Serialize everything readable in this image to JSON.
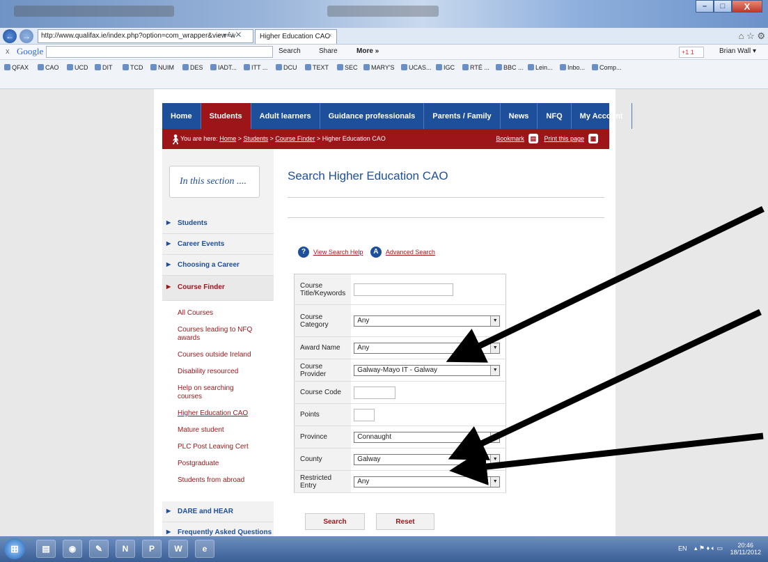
{
  "browser": {
    "address": "http://www.qualifax.ie/index.php?option=com_wrapper&view=w",
    "tab_title": "Higher Education CAO",
    "tab_close": "×",
    "nav_back": "←",
    "nav_forward": "→",
    "address_controls": "⌕ ▾ ↻ ✕",
    "home_star_gear": "⌂ ☆ ⚙",
    "window_buttons": {
      "minimize": "–",
      "maximize": "□",
      "close": "X"
    }
  },
  "google_toolbar": {
    "close": "x",
    "logo": "Google",
    "search_label": "Search",
    "share_label": "Share",
    "more_label": "More »",
    "plus_one": "+1  1",
    "user": "Brian Wall ▾"
  },
  "favorites": [
    "QFAX",
    "CAO",
    "UCD",
    "DIT",
    "TCD",
    "NUIM",
    "DES",
    "IADT...",
    "ITT ...",
    "DCU",
    "TEXT",
    "SEC",
    "MARY'S",
    "UCAS...",
    "IGC",
    "RTÉ ...",
    "BBC ...",
    "Lein...",
    "Inbo...",
    "Comp..."
  ],
  "mainnav": [
    "Home",
    "Students",
    "Adult learners",
    "Guidance professionals",
    "Parents / Family",
    "News",
    "NFQ",
    "My Account"
  ],
  "breadcrumb": {
    "prefix": "You are here:",
    "home": "Home",
    "students": "Students",
    "course_finder": "Course Finder",
    "current": "Higher Education CAO",
    "sep": ">",
    "bookmark": "Bookmark",
    "print": "Print this page"
  },
  "sidebar": {
    "title": "In this section ....",
    "items_top": [
      "Students",
      "Career Events",
      "Choosing a Career"
    ],
    "active": "Course Finder",
    "subitems": [
      "All Courses",
      "Courses leading to NFQ awards",
      "Courses outside Ireland",
      "Disability resourced",
      "Help on searching courses",
      "Higher Education CAO",
      "Mature student",
      "PLC Post Leaving Cert",
      "Postgraduate",
      "Students from abroad"
    ],
    "items_bottom": [
      "DARE and HEAR",
      "Frequently Asked Questions"
    ]
  },
  "main": {
    "heading": "Search Higher Education CAO",
    "help_icon": "?",
    "help_link": "View Search Help",
    "advanced_icon": "A",
    "advanced_link": "Advanced Search"
  },
  "form": {
    "course_title_label": "Course Title/Keywords",
    "course_title_value": "",
    "course_category_label": "Course Category",
    "course_category_value": "Any",
    "award_name_label": "Award Name",
    "award_name_value": "Any",
    "course_provider_label": "Course Provider",
    "course_provider_value": "Galway-Mayo IT - Galway",
    "course_code_label": "Course Code",
    "course_code_value": "",
    "points_label": "Points",
    "points_value": "",
    "province_label": "Province",
    "province_value": "Connaught",
    "county_label": "County",
    "county_value": "Galway",
    "restricted_entry_label": "Restricted Entry",
    "restricted_entry_value": "Any",
    "search_button": "Search",
    "reset_button": "Reset"
  },
  "taskbar": {
    "lang": "EN",
    "time": "20:46",
    "date": "18/11/2012"
  },
  "colors": {
    "brand_blue": "#1e4f9a",
    "brand_red": "#9d1419",
    "annotation_arrows": "#000000"
  }
}
